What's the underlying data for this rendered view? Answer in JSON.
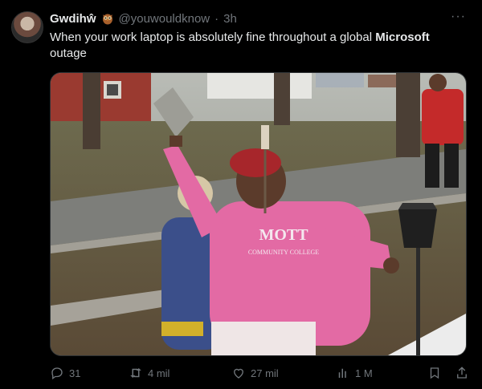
{
  "author": {
    "name": "Gwdihŵ",
    "handle": "@youwouldknow",
    "separator": "·",
    "time": "3h"
  },
  "tweet": {
    "text_before": "When your work laptop is absolutely fine throughout a global ",
    "text_bold": "Microsoft",
    "text_after": " outage"
  },
  "media": {
    "sweatshirt_text_line1": "MOTT",
    "sweatshirt_text_line2": "COMMUNITY COLLEGE"
  },
  "actions": {
    "replies": "31",
    "retweets": "4 mil",
    "likes": "27 mil",
    "views": "1 M"
  },
  "icons": {
    "avatar": "avatar-image",
    "owl": "owl-emoji-icon",
    "more": "more-options-icon",
    "reply": "reply-icon",
    "retweet": "retweet-icon",
    "like": "heart-icon",
    "views": "views-icon",
    "bookmark": "bookmark-icon",
    "share": "share-icon"
  },
  "colors": {
    "background": "#000000",
    "text": "#e7e9ea",
    "muted": "#71767b",
    "border": "#2f3336"
  }
}
